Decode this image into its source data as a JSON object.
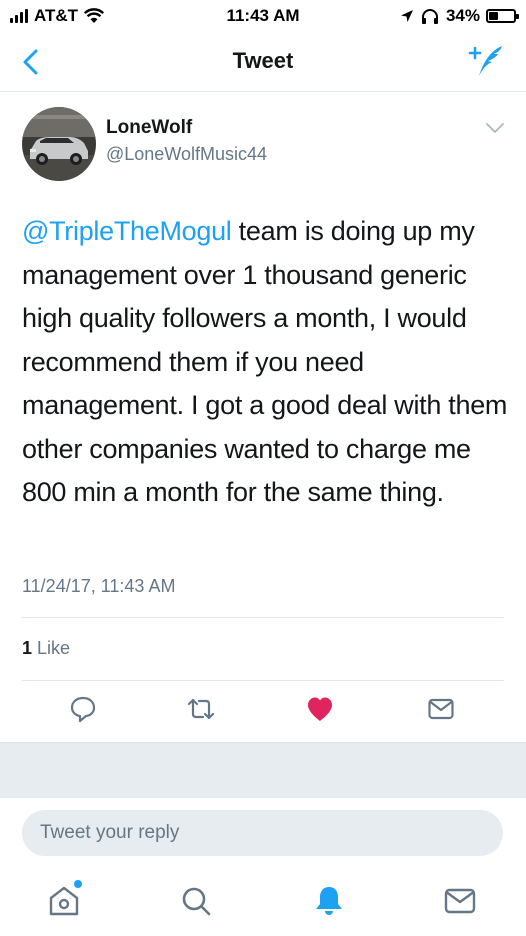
{
  "status_bar": {
    "carrier": "AT&T",
    "time": "11:43 AM",
    "battery_percent": "34%",
    "battery_level": 0.34
  },
  "nav": {
    "title": "Tweet",
    "back_icon": "chevron-left-icon",
    "compose_icon": "compose-tweet-icon"
  },
  "tweet": {
    "display_name": "LoneWolf",
    "handle": "@LoneWolfMusic44",
    "mention": "@TripleTheMogul",
    "body": " team is doing up my management over 1 thousand generic high quality followers a month, I would recommend them if you need management. I got a good deal with them other companies wanted to charge me 800 min a month for the same thing.",
    "timestamp": "11/24/17, 11:43 AM",
    "like_count": "1",
    "like_label": " Like"
  },
  "reply": {
    "placeholder": "Tweet your reply"
  },
  "colors": {
    "accent": "#1da1f2",
    "like": "#e0245e",
    "secondary_text": "#657786"
  },
  "icons": {
    "actions": [
      "reply-icon",
      "retweet-icon",
      "like-heart-icon",
      "direct-message-icon"
    ],
    "tabs": [
      "home-icon",
      "search-icon",
      "notifications-icon",
      "messages-icon"
    ]
  }
}
